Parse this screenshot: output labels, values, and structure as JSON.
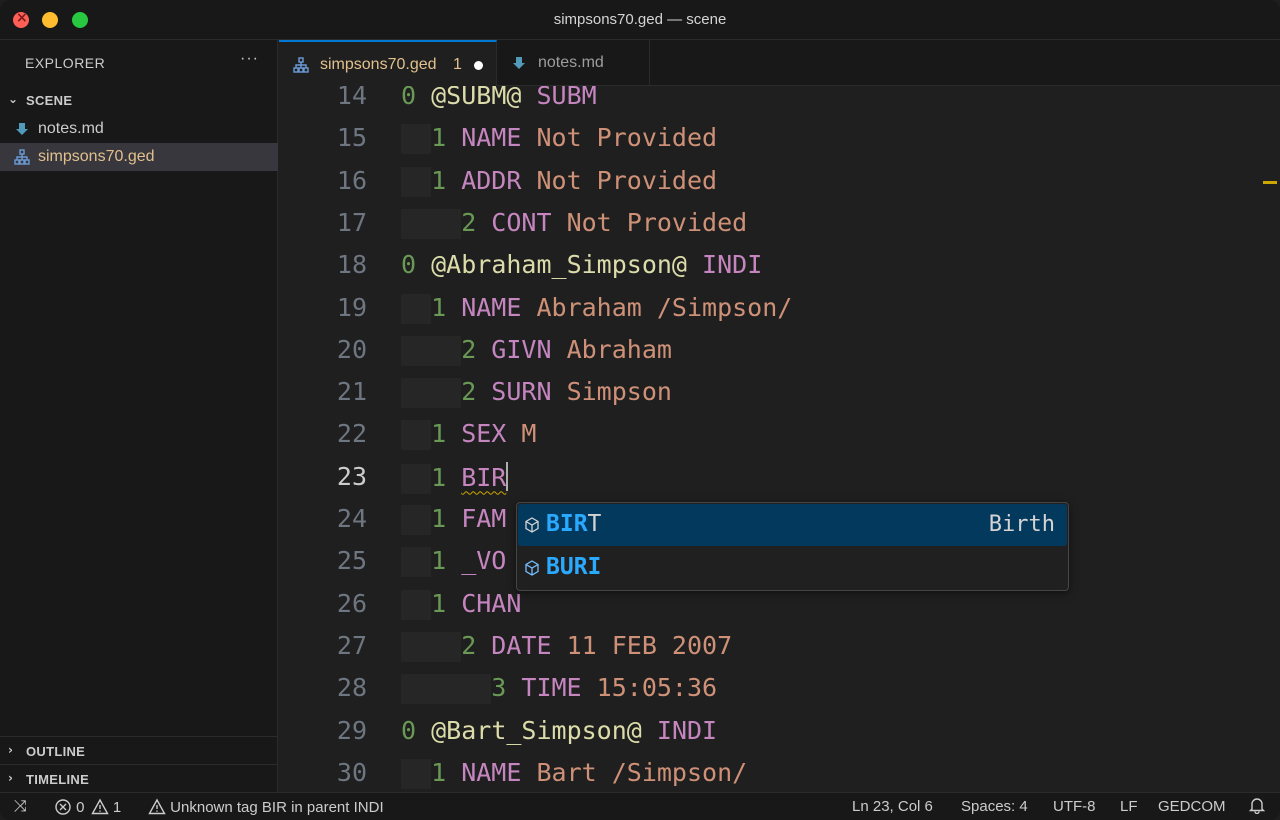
{
  "window": {
    "title": "simpsons70.ged — scene"
  },
  "sidebar": {
    "header": "EXPLORER",
    "more": "···",
    "folder": "SCENE",
    "files": [
      {
        "name": "notes.md",
        "icon": "markdown-icon"
      },
      {
        "name": "simpsons70.ged",
        "icon": "gedcom-tree-icon",
        "active": true
      }
    ],
    "outline": "OUTLINE",
    "timeline": "TIMELINE"
  },
  "tabs": [
    {
      "label": "simpsons70.ged",
      "count": "1",
      "modified": true,
      "active": true,
      "icon": "gedcom-tree-icon"
    },
    {
      "label": "notes.md",
      "active": false,
      "icon": "markdown-icon"
    }
  ],
  "editor": {
    "lines": [
      {
        "n": "14",
        "tokens": [
          [
            "lvl",
            "0 "
          ],
          [
            "xref",
            "@SUBM@ "
          ],
          [
            "tag",
            "SUBM"
          ]
        ]
      },
      {
        "n": "15",
        "indent": 1,
        "tokens": [
          [
            "lvl",
            "1 "
          ],
          [
            "tag",
            "NAME "
          ],
          [
            "val",
            "Not Provided"
          ]
        ]
      },
      {
        "n": "16",
        "indent": 1,
        "tokens": [
          [
            "lvl",
            "1 "
          ],
          [
            "tag",
            "ADDR "
          ],
          [
            "val",
            "Not Provided"
          ]
        ]
      },
      {
        "n": "17",
        "indent": 2,
        "tokens": [
          [
            "lvl",
            "2 "
          ],
          [
            "tag",
            "CONT "
          ],
          [
            "val",
            "Not Provided"
          ]
        ]
      },
      {
        "n": "18",
        "tokens": [
          [
            "lvl",
            "0 "
          ],
          [
            "xref",
            "@Abraham_Simpson@ "
          ],
          [
            "tag",
            "INDI"
          ]
        ]
      },
      {
        "n": "19",
        "indent": 1,
        "tokens": [
          [
            "lvl",
            "1 "
          ],
          [
            "tag",
            "NAME "
          ],
          [
            "val",
            "Abraham /Simpson/"
          ]
        ]
      },
      {
        "n": "20",
        "indent": 2,
        "tokens": [
          [
            "lvl",
            "2 "
          ],
          [
            "tag",
            "GIVN "
          ],
          [
            "val",
            "Abraham"
          ]
        ]
      },
      {
        "n": "21",
        "indent": 2,
        "tokens": [
          [
            "lvl",
            "2 "
          ],
          [
            "tag",
            "SURN "
          ],
          [
            "val",
            "Simpson"
          ]
        ]
      },
      {
        "n": "22",
        "indent": 1,
        "tokens": [
          [
            "lvl",
            "1 "
          ],
          [
            "tag",
            "SEX "
          ],
          [
            "val",
            "M"
          ]
        ]
      },
      {
        "n": "23",
        "indent": 1,
        "current": true,
        "tokens": [
          [
            "lvl",
            "1 "
          ],
          [
            "tag squig",
            "BIR"
          ]
        ]
      },
      {
        "n": "24",
        "indent": 1,
        "tokens": [
          [
            "lvl",
            "1 "
          ],
          [
            "tag",
            "FAM"
          ]
        ]
      },
      {
        "n": "25",
        "indent": 1,
        "tokens": [
          [
            "lvl",
            "1 "
          ],
          [
            "tag",
            "_VO"
          ]
        ]
      },
      {
        "n": "26",
        "indent": 1,
        "tokens": [
          [
            "lvl",
            "1 "
          ],
          [
            "tag",
            "CHAN"
          ]
        ]
      },
      {
        "n": "27",
        "indent": 2,
        "tokens": [
          [
            "lvl",
            "2 "
          ],
          [
            "tag",
            "DATE "
          ],
          [
            "val",
            "11 FEB 2007"
          ]
        ]
      },
      {
        "n": "28",
        "indent": 3,
        "tokens": [
          [
            "lvl",
            "3 "
          ],
          [
            "tag",
            "TIME "
          ],
          [
            "val",
            "15:05:36"
          ]
        ]
      },
      {
        "n": "29",
        "tokens": [
          [
            "lvl",
            "0 "
          ],
          [
            "xref",
            "@Bart_Simpson@ "
          ],
          [
            "tag",
            "INDI"
          ]
        ]
      },
      {
        "n": "30",
        "indent": 1,
        "tokens": [
          [
            "lvl",
            "1 "
          ],
          [
            "tag",
            "NAME "
          ],
          [
            "val",
            "Bart /Simpson/"
          ]
        ]
      }
    ]
  },
  "suggest": {
    "items": [
      {
        "match": "BIR",
        "rest": "T",
        "detail": "Birth",
        "selected": true,
        "icon": "symbol-property-icon"
      },
      {
        "match": "BURI",
        "rest": "",
        "detail": "",
        "selected": false,
        "icon": "symbol-property-icon"
      }
    ]
  },
  "statusbar": {
    "errors": "0",
    "warnings": "1",
    "message": "Unknown tag BIR in parent INDI",
    "position": "Ln 23, Col 6",
    "spaces": "Spaces: 4",
    "encoding": "UTF-8",
    "eol": "LF",
    "language": "GEDCOM"
  },
  "colors": {
    "accent": "#0078d4",
    "modified": "#e2c08d",
    "suggest_selected": "#04395e",
    "match": "#2aaaff"
  }
}
